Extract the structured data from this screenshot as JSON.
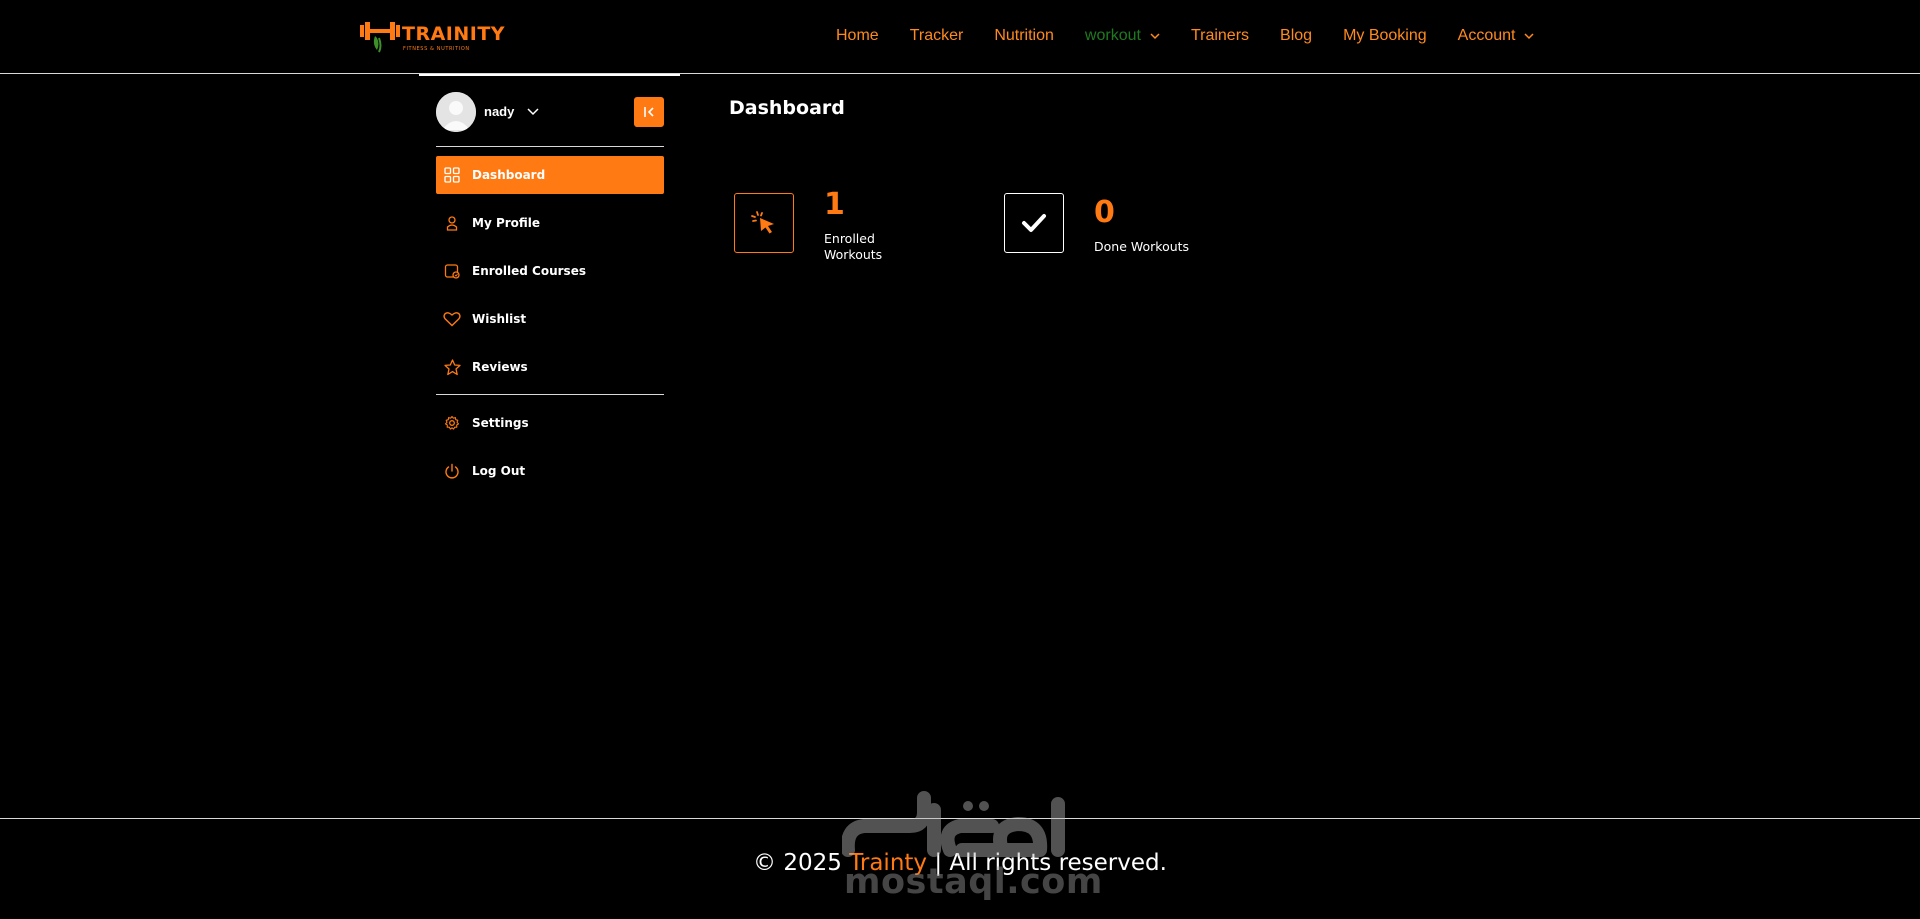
{
  "header": {
    "logo": {
      "brand": "TRAINITY",
      "tagline": "FITNESS & NUTRITION"
    },
    "nav": [
      {
        "label": "Home",
        "active": false,
        "dropdown": false
      },
      {
        "label": "Tracker",
        "active": false,
        "dropdown": false
      },
      {
        "label": "Nutrition",
        "active": false,
        "dropdown": false
      },
      {
        "label": "workout",
        "active": true,
        "dropdown": true
      },
      {
        "label": "Trainers",
        "active": false,
        "dropdown": false
      },
      {
        "label": "Blog",
        "active": false,
        "dropdown": false
      },
      {
        "label": "My Booking",
        "active": false,
        "dropdown": false
      },
      {
        "label": "Account",
        "active": false,
        "dropdown": true
      }
    ]
  },
  "sidebar": {
    "user": {
      "name": "nady"
    },
    "items": [
      {
        "label": "Dashboard",
        "icon": "grid-icon",
        "active": true
      },
      {
        "label": "My Profile",
        "icon": "user-icon",
        "active": false
      },
      {
        "label": "Enrolled Courses",
        "icon": "courses-icon",
        "active": false
      },
      {
        "label": "Wishlist",
        "icon": "heart-icon",
        "active": false
      },
      {
        "label": "Reviews",
        "icon": "star-icon",
        "active": false
      }
    ],
    "bottom_items": [
      {
        "label": "Settings",
        "icon": "gear-icon"
      },
      {
        "label": "Log Out",
        "icon": "power-icon"
      }
    ]
  },
  "main": {
    "title": "Dashboard",
    "stats": [
      {
        "value": "1",
        "label_line1": "Enrolled",
        "label_line2": "Workouts",
        "icon": "cursor-click-icon"
      },
      {
        "value": "0",
        "label": "Done Workouts",
        "icon": "check-icon"
      }
    ]
  },
  "footer": {
    "prefix": "© 2025 ",
    "brand": "Trainty",
    "suffix": " | All rights reserved."
  },
  "watermark": {
    "arabic": "مستقل",
    "latin": "mostaql.com"
  },
  "colors": {
    "accent": "#ff7a12",
    "active_nav": "#1f7a1f",
    "background": "#000000",
    "text": "#ffffff"
  }
}
